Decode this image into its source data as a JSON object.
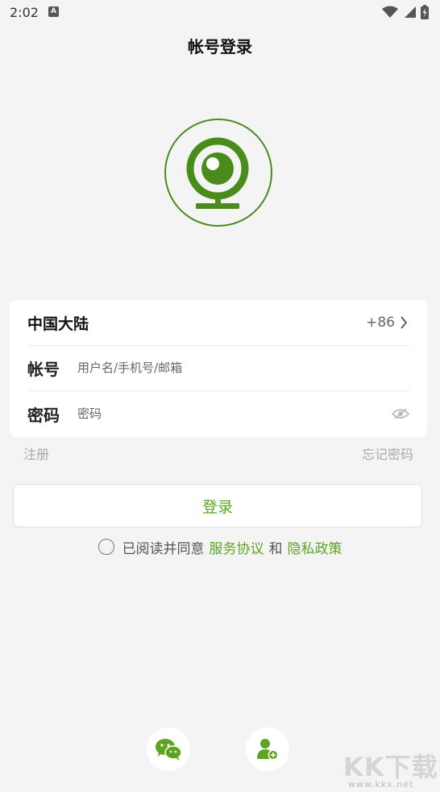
{
  "status_bar": {
    "time": "2:02",
    "notification_letter": "A",
    "icons": [
      "wifi-icon",
      "cell-signal-icon",
      "battery-charging-icon"
    ]
  },
  "header": {
    "title": "帐号登录"
  },
  "logo": {
    "icon": "webcam-logo-icon",
    "color": "#4a8c1c"
  },
  "form": {
    "region_label": "中国大陆",
    "region_code": "+86",
    "account_label": "帐号",
    "account_placeholder": "用户名/手机号/邮箱",
    "account_value": "",
    "password_label": "密码",
    "password_placeholder": "密码",
    "password_value": ""
  },
  "links": {
    "register": "注册",
    "forgot_password": "忘记密码"
  },
  "login_button": {
    "label": "登录"
  },
  "agreement": {
    "prefix": "已阅读并同意",
    "terms": "服务协议",
    "conjunction": "和",
    "privacy": "隐私政策"
  },
  "bottom_actions": {
    "icons": [
      "wechat-icon",
      "add-user-icon"
    ]
  },
  "watermark": {
    "logo_text": "KK下载",
    "url": "www.kkx.net"
  },
  "colors": {
    "accent": "#5ca421",
    "background": "#f4f4f4"
  }
}
